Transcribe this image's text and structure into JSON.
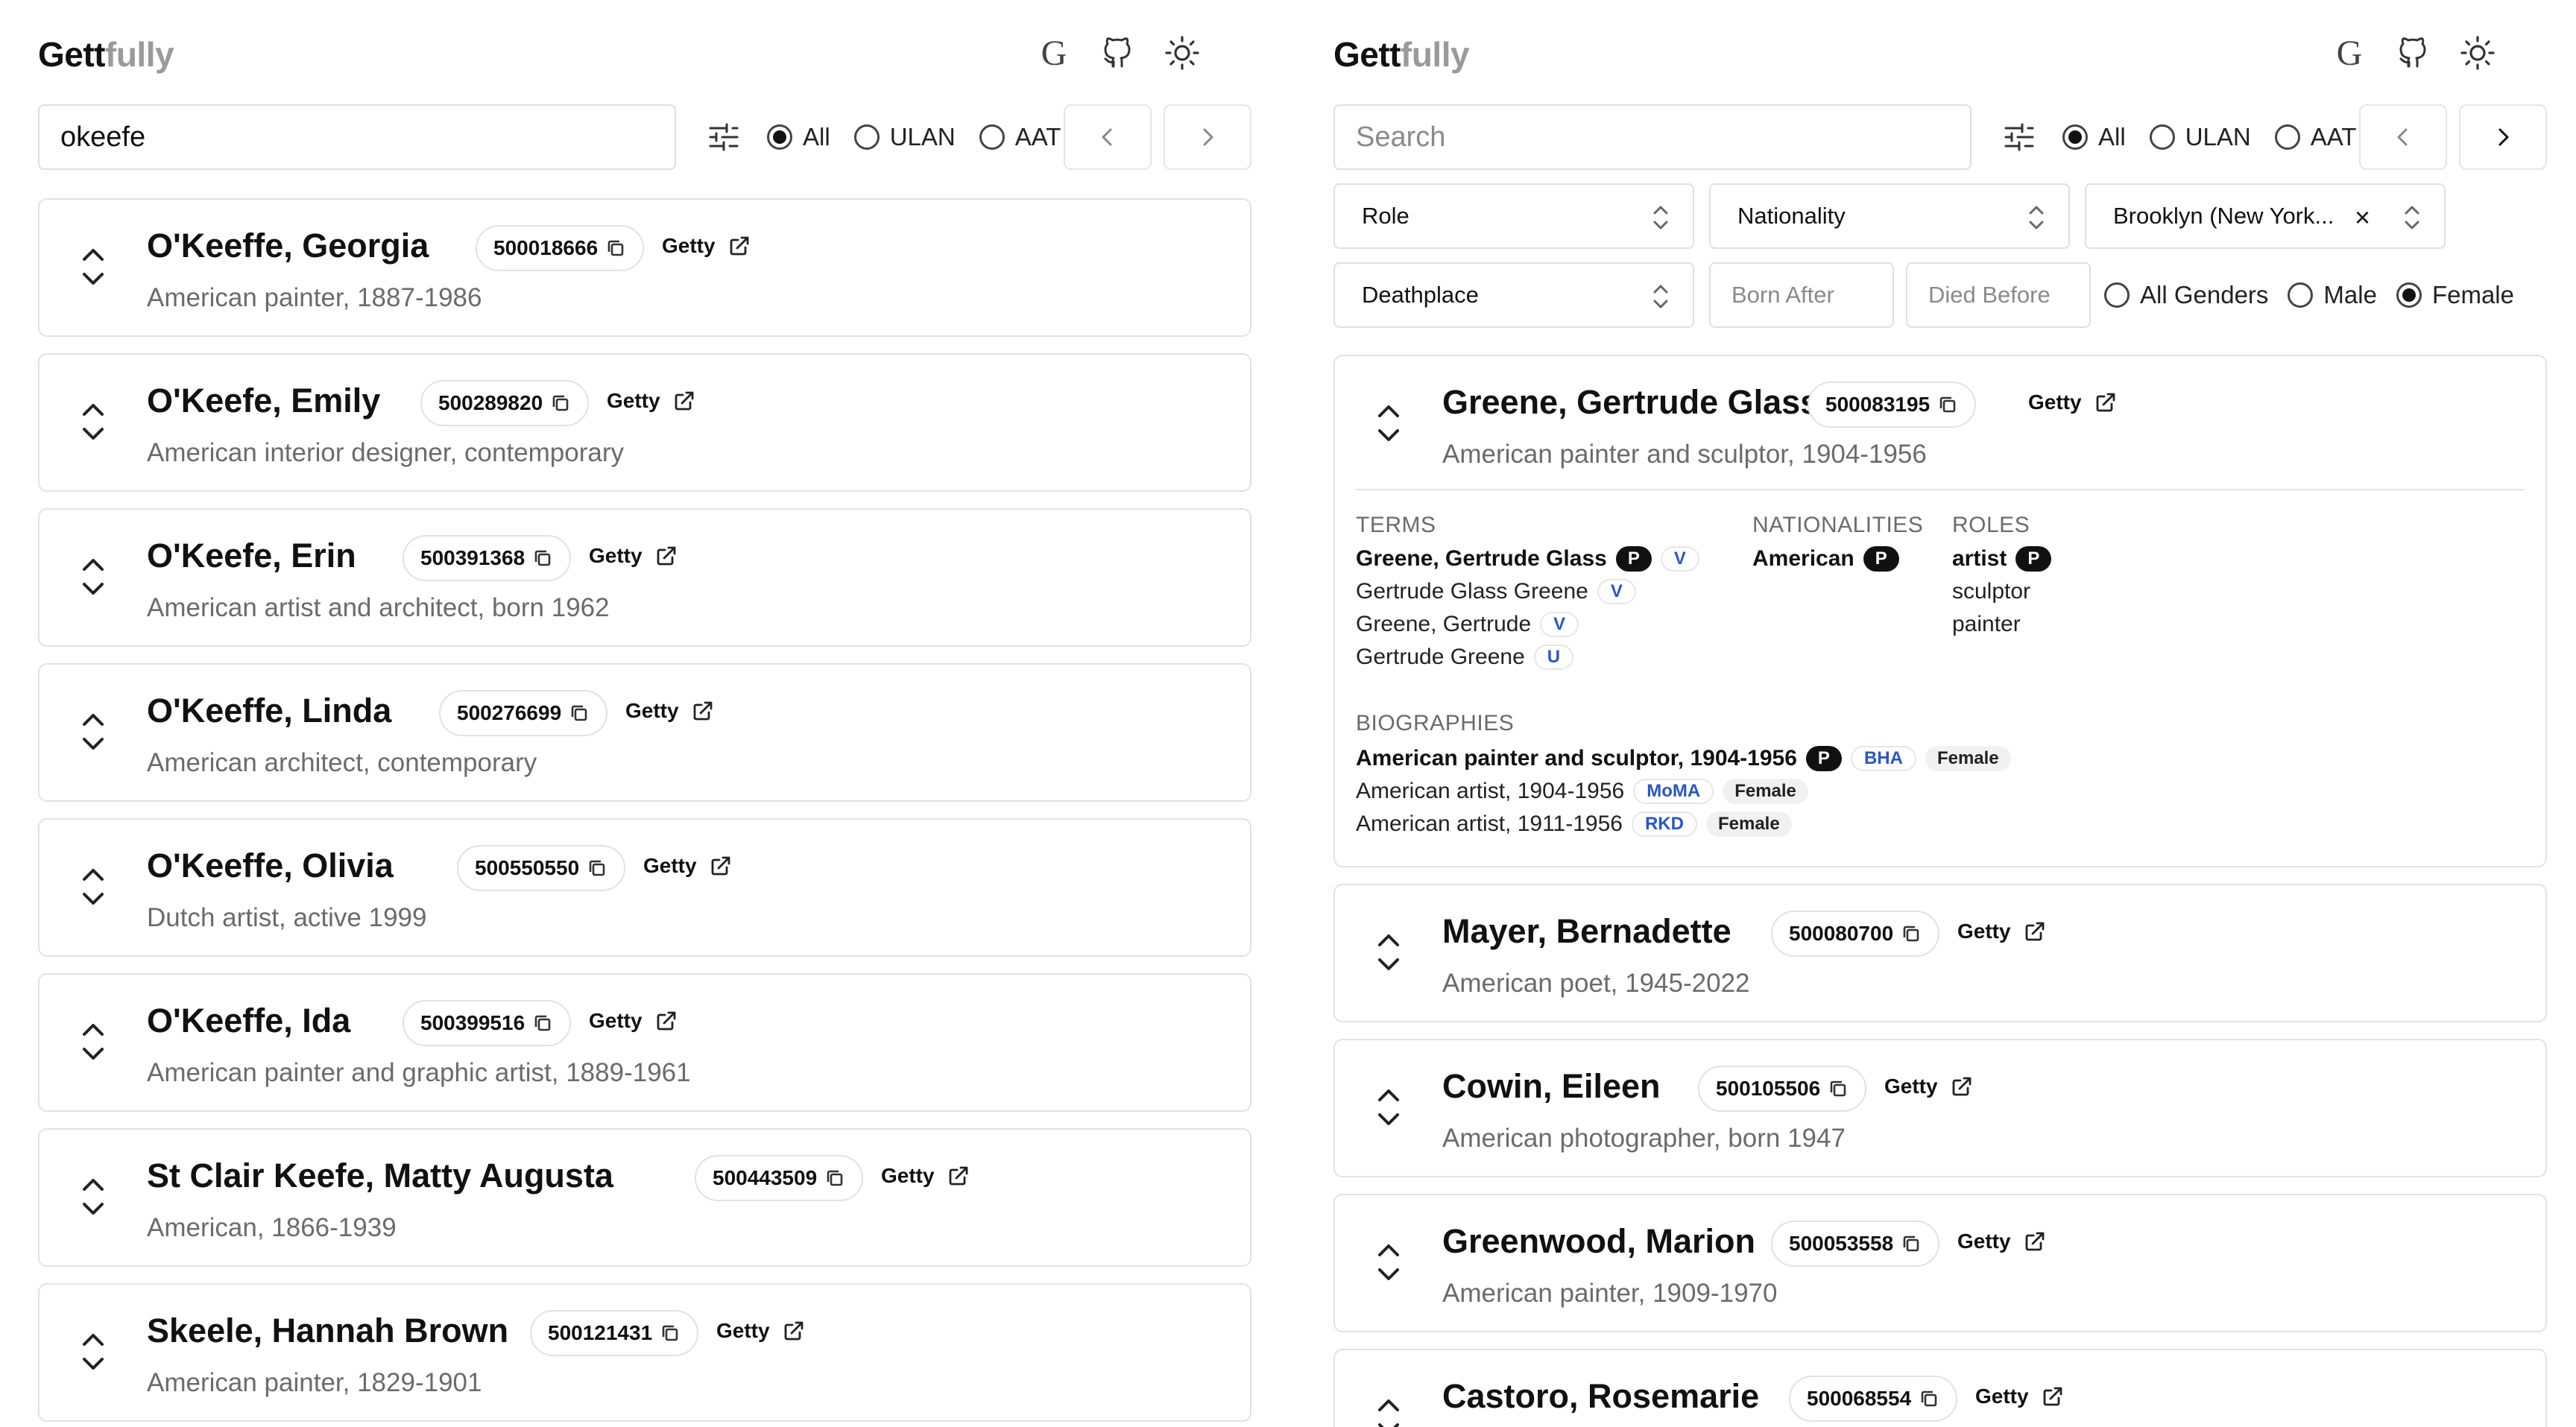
{
  "left": {
    "brand": {
      "part1": "Gett",
      "part2": "fully"
    },
    "search_value": "okeefe",
    "radios": [
      {
        "label": "All",
        "checked": true
      },
      {
        "label": "ULAN",
        "checked": false
      },
      {
        "label": "AAT",
        "checked": false
      }
    ],
    "cards": [
      {
        "name": "O'Keeffe, Georgia",
        "id": "500018666",
        "link": "Getty",
        "desc": "American painter, 1887-1986"
      },
      {
        "name": "O'Keefe, Emily",
        "id": "500289820",
        "link": "Getty",
        "desc": "American interior designer, contemporary"
      },
      {
        "name": "O'Keefe, Erin",
        "id": "500391368",
        "link": "Getty",
        "desc": "American artist and architect, born 1962"
      },
      {
        "name": "O'Keeffe, Linda",
        "id": "500276699",
        "link": "Getty",
        "desc": "American architect, contemporary"
      },
      {
        "name": "O'Keeffe, Olivia",
        "id": "500550550",
        "link": "Getty",
        "desc": "Dutch artist, active 1999"
      },
      {
        "name": "O'Keeffe, Ida",
        "id": "500399516",
        "link": "Getty",
        "desc": "American painter and graphic artist, 1889-1961"
      },
      {
        "name": "St Clair Keefe, Matty Augusta",
        "id": "500443509",
        "link": "Getty",
        "desc": "American, 1866-1939"
      },
      {
        "name": "Skeele, Hannah Brown",
        "id": "500121431",
        "link": "Getty",
        "desc": "American painter, 1829-1901"
      }
    ]
  },
  "right": {
    "brand": {
      "part1": "Gett",
      "part2": "fully"
    },
    "search_placeholder": "Search",
    "radios": [
      {
        "label": "All",
        "checked": true
      },
      {
        "label": "ULAN",
        "checked": false
      },
      {
        "label": "AAT",
        "checked": false
      }
    ],
    "filters": {
      "role": "Role",
      "nationality": "Nationality",
      "birthplace": "Brooklyn (New York...",
      "deathplace": "Deathplace",
      "born_after": "Born After",
      "died_before": "Died Before",
      "genders": [
        {
          "label": "All Genders",
          "checked": false
        },
        {
          "label": "Male",
          "checked": false
        },
        {
          "label": "Female",
          "checked": true
        }
      ]
    },
    "expanded": {
      "name": "Greene, Gertrude Glass",
      "id": "500083195",
      "link": "Getty",
      "desc": "American painter and sculptor, 1904-1956",
      "terms_head": "TERMS",
      "terms": [
        {
          "text": "Greene, Gertrude Glass",
          "tags": [
            "P",
            "V"
          ]
        },
        {
          "text": "Gertrude Glass Greene",
          "tags": [
            "V"
          ]
        },
        {
          "text": "Greene, Gertrude",
          "tags": [
            "V"
          ]
        },
        {
          "text": "Gertrude Greene",
          "tags": [
            "U"
          ]
        }
      ],
      "nationalities_head": "NATIONALITIES",
      "nationality": {
        "text": "American",
        "tag": "P"
      },
      "roles_head": "ROLES",
      "roles": [
        {
          "text": "artist",
          "tag": "P"
        },
        {
          "text": "sculptor"
        },
        {
          "text": "painter"
        }
      ],
      "bios_head": "BIOGRAPHIES",
      "bios": [
        {
          "text": "American painter and sculptor, 1904-1956",
          "tag": "P",
          "source": "BHA",
          "gender": "Female"
        },
        {
          "text": "American artist, 1904-1956",
          "source": "MoMA",
          "gender": "Female"
        },
        {
          "text": "American artist, 1911-1956",
          "source": "RKD",
          "gender": "Female"
        }
      ]
    },
    "cards": [
      {
        "name": "Mayer, Bernadette",
        "id": "500080700",
        "link": "Getty",
        "desc": "American poet, 1945-2022"
      },
      {
        "name": "Cowin, Eileen",
        "id": "500105506",
        "link": "Getty",
        "desc": "American photographer, born 1947"
      },
      {
        "name": "Greenwood, Marion",
        "id": "500053558",
        "link": "Getty",
        "desc": "American painter, 1909-1970"
      },
      {
        "name": "Castoro, Rosemarie",
        "id": "500068554",
        "link": "Getty",
        "desc": ""
      }
    ]
  }
}
